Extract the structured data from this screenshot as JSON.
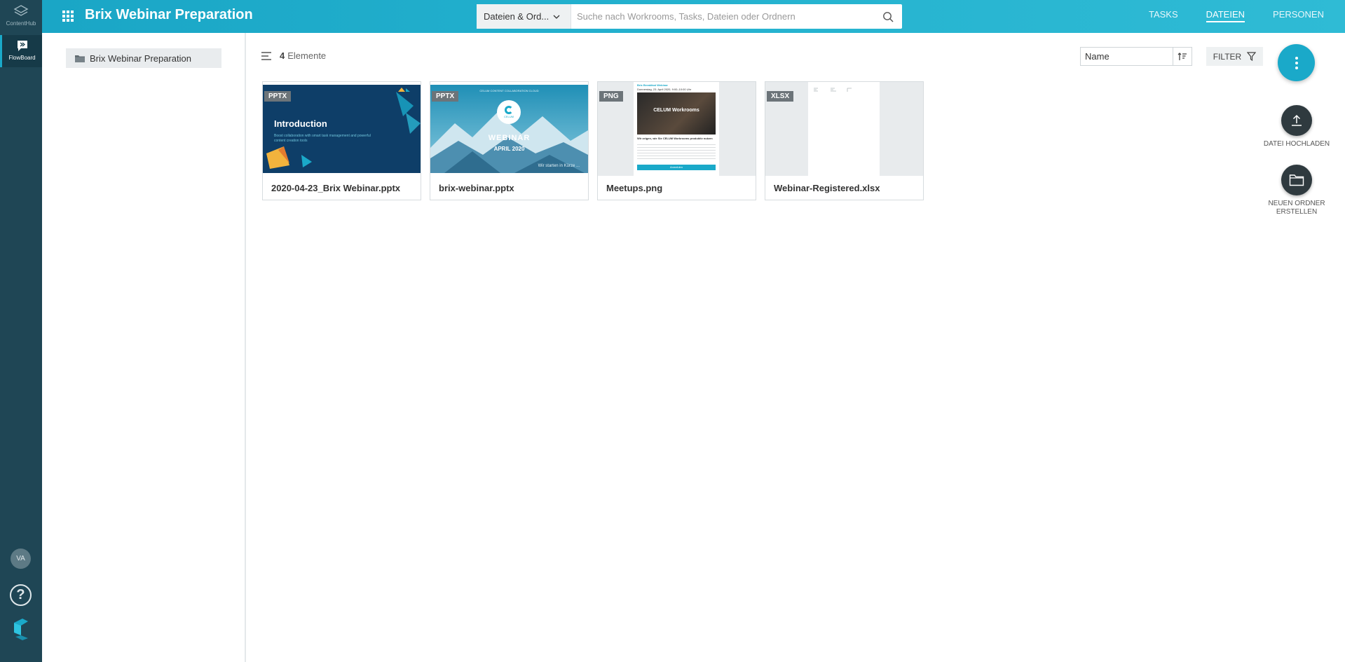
{
  "rail": {
    "contenthub_label": "ContentHub",
    "flowboard_label": "FlowBoard",
    "avatar_initials": "VA",
    "help_glyph": "?"
  },
  "header": {
    "title": "Brix Webinar Preparation",
    "search_scope": "Dateien & Ord...",
    "search_placeholder": "Suche nach Workrooms, Tasks, Dateien oder Ordnern",
    "tabs": [
      {
        "label": "TASKS",
        "active": false
      },
      {
        "label": "DATEIEN",
        "active": true
      },
      {
        "label": "PERSONEN",
        "active": false
      }
    ]
  },
  "sidebar": {
    "folder_label": "Brix Webinar Preparation"
  },
  "main": {
    "count": "4",
    "count_label": "Elemente",
    "sort_label": "Name",
    "filter_label": "FILTER",
    "upload_label": "DATEI HOCHLADEN",
    "new_folder_label_1": "NEUEN ORDNER",
    "new_folder_label_2": "ERSTELLEN"
  },
  "files": [
    {
      "type": "PPTX",
      "name": "2020-04-23_Brix Webinar.pptx",
      "thumb_title": "Introduction",
      "thumb_sub": "Boost collaboration with smart task management and powerful content creation tools"
    },
    {
      "type": "PPTX",
      "name": "brix-webinar.pptx",
      "thumb_title": "WEBINAR",
      "thumb_sub": "APRIL 2020",
      "thumb_top": "CELUM CONTENT COLLABORATION CLOUD",
      "thumb_logo": "CELUM",
      "thumb_foot": "Wir starten in Kürze ..."
    },
    {
      "type": "PNG",
      "name": "Meetups.png",
      "thumb_title": "Brix Breakfast Webinar",
      "thumb_sub": "Donnerstag, 23. April 2020, 9:00–10:00 Uhr",
      "thumb_banner": "CELUM Workrooms",
      "thumb_text": "Wir zeigen, wie Sie CELUM Workrooms produktiv nutzen",
      "thumb_button": "Anmelden"
    },
    {
      "type": "XLSX",
      "name": "Webinar-Registered.xlsx"
    }
  ],
  "colors": {
    "accent": "#1aa9c9",
    "rail": "#1f4655",
    "topbar": "#24b2cf",
    "badge": "#6c7479"
  }
}
